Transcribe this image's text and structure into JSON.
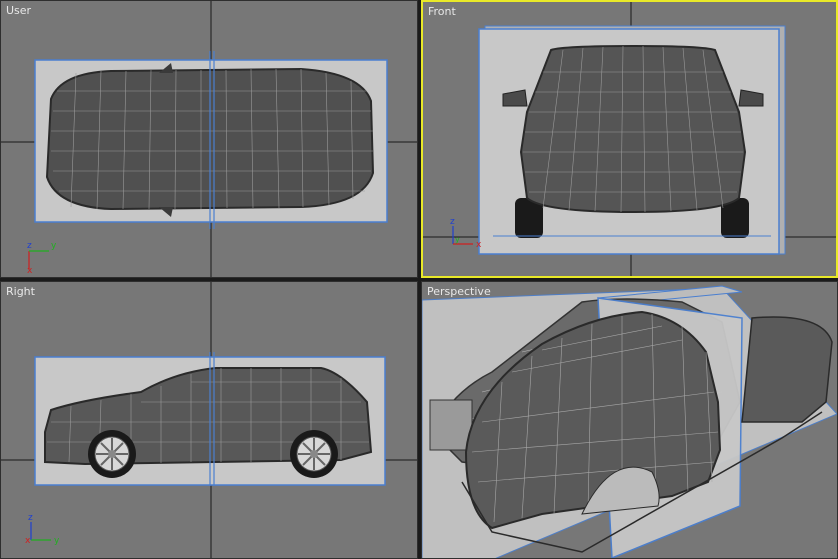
{
  "viewports": [
    {
      "id": "user",
      "label": "User"
    },
    {
      "id": "front",
      "label": "Front"
    },
    {
      "id": "right",
      "label": "Right"
    },
    {
      "id": "perspective",
      "label": "Perspective"
    }
  ],
  "axes": {
    "x": "x",
    "y": "y",
    "z": "z"
  },
  "colors": {
    "background": "#777777",
    "grid": "#1a1a1a",
    "active_border": "#e9e928",
    "plane_frame": "#4a7fd0",
    "plane_fill": "#c8c8c8",
    "mesh": "#505050",
    "wire": "#b8b8b8",
    "axis_x": "#d02020",
    "axis_y": "#20b020",
    "axis_z": "#2040d0"
  }
}
